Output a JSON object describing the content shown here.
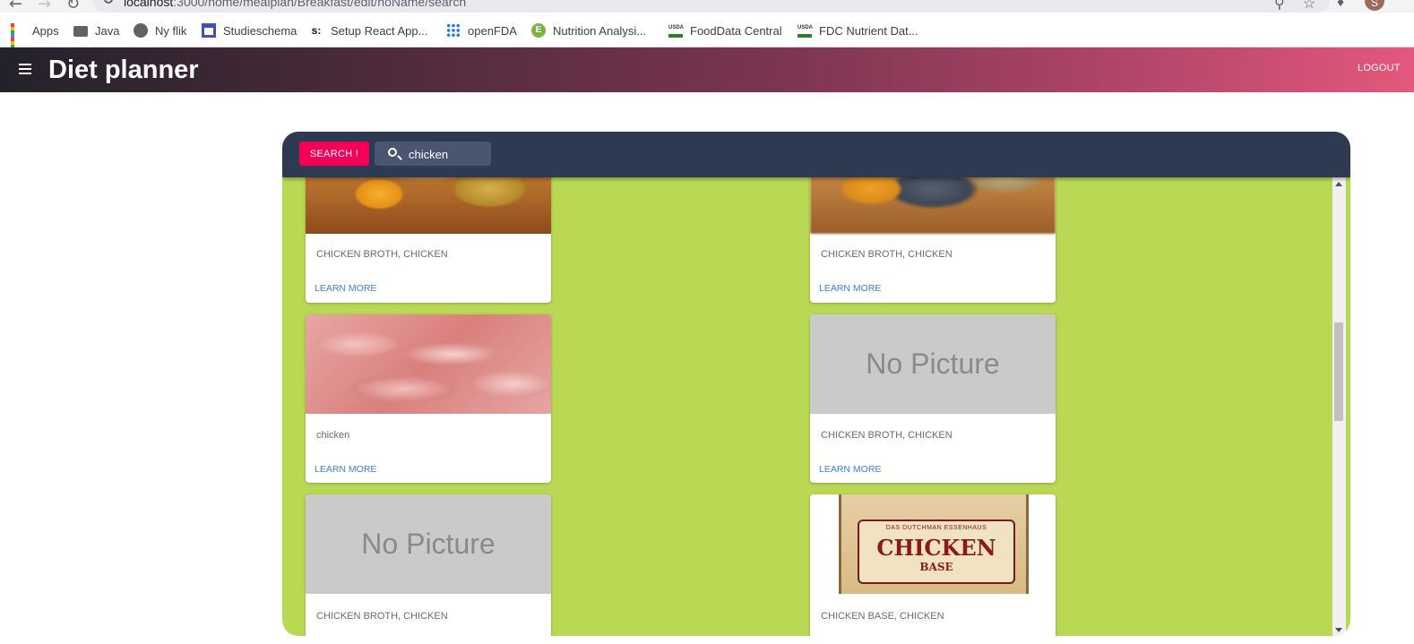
{
  "browser": {
    "url_host": "localhost",
    "url_path": ":3000/home/mealplan/Breakfast/edit/noName/search",
    "avatar_letter": "S",
    "bookmarks": [
      {
        "label": "Apps",
        "icon": "apps-grid-icon"
      },
      {
        "label": "Java",
        "icon": "folder-icon"
      },
      {
        "label": "Ny flik",
        "icon": "globe-icon"
      },
      {
        "label": "Studieschema",
        "icon": "calendar-icon"
      },
      {
        "label": "Setup React App...",
        "icon": "s-logo-icon"
      },
      {
        "label": "openFDA",
        "icon": "dots-grid-icon"
      },
      {
        "label": "Nutrition Analysi...",
        "icon": "nutrition-logo-icon"
      },
      {
        "label": "FoodData Central",
        "icon": "usda-icon"
      },
      {
        "label": "FDC Nutrient Dat...",
        "icon": "usda-icon"
      }
    ]
  },
  "app": {
    "title": "Diet planner",
    "logout_label": "LOGOUT",
    "colors": {
      "search_button": "#f50057",
      "panel": "#b9d954",
      "search_bar": "#2e3a51",
      "link": "#3f7fd9"
    }
  },
  "search": {
    "button_label": "SEARCH !",
    "value": "chicken"
  },
  "cards": [
    {
      "title": "CHICKEN BROTH, CHICKEN",
      "action": "LEARN MORE",
      "image": "broth"
    },
    {
      "title": "CHICKEN BROTH, CHICKEN",
      "action": "LEARN MORE",
      "image": "broth"
    },
    {
      "title": "chicken",
      "action": "LEARN MORE",
      "image": "raw-chicken"
    },
    {
      "title": "CHICKEN BROTH, CHICKEN",
      "action": "LEARN MORE",
      "image": "no-picture",
      "image_text": "No Picture"
    },
    {
      "title": "CHICKEN BROTH, CHICKEN",
      "action": "",
      "image": "no-picture",
      "image_text": "No Picture"
    },
    {
      "title": "CHICKEN BASE, CHICKEN",
      "action": "",
      "image": "chicken-base-bag",
      "image_text": {
        "brand": "DAS DUTCHMAN ESSENHAUS",
        "word": "CHICKEN",
        "sub": "BASE"
      }
    }
  ]
}
